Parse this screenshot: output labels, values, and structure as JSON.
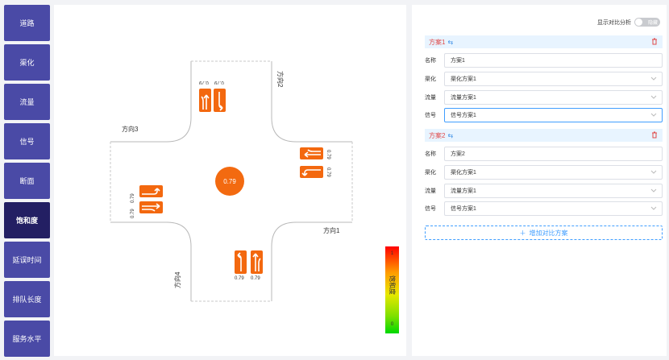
{
  "sidebar": {
    "items": [
      {
        "label": "道路"
      },
      {
        "label": "渠化"
      },
      {
        "label": "流量"
      },
      {
        "label": "信号"
      },
      {
        "label": "断面"
      },
      {
        "label": "饱和度"
      },
      {
        "label": "延误时间"
      },
      {
        "label": "排队长度"
      },
      {
        "label": "服务水平"
      }
    ],
    "active": "饱和度"
  },
  "intersection": {
    "directions": {
      "d1": "方向1",
      "d2": "方向2",
      "d3": "方向3",
      "d4": "方向4"
    },
    "saturation": "0.79",
    "lanes": {
      "north": [
        "0.79",
        "0.79"
      ],
      "east": [
        "0.79",
        "0.79"
      ],
      "south": [
        "0.79",
        "0.79"
      ],
      "west": [
        "0.79",
        "0.79"
      ]
    }
  },
  "legend": {
    "title": "饱和度",
    "max": "1",
    "min": "0"
  },
  "panel": {
    "toggle_label": "显示对比分析",
    "toggle_state": "隐藏",
    "schemes": [
      {
        "title": "方案1",
        "fields": {
          "name_label": "名称",
          "name_value": "方案1",
          "channel_label": "渠化",
          "channel_value": "渠化方案1",
          "flow_label": "流量",
          "flow_value": "流量方案1",
          "signal_label": "信号",
          "signal_value": "信号方案1"
        }
      },
      {
        "title": "方案2",
        "fields": {
          "name_label": "名称",
          "name_value": "方案2",
          "channel_label": "渠化",
          "channel_value": "渠化方案1",
          "flow_label": "流量",
          "flow_value": "流量方案1",
          "signal_label": "信号",
          "signal_value": "信号方案1"
        }
      }
    ],
    "add_label": "增加对比方案"
  },
  "colors": {
    "accent": "#f36a10",
    "sidebar": "#4a4aa6",
    "sidebar_active": "#231f63",
    "link": "#409eff",
    "danger": "#e04a4a"
  }
}
